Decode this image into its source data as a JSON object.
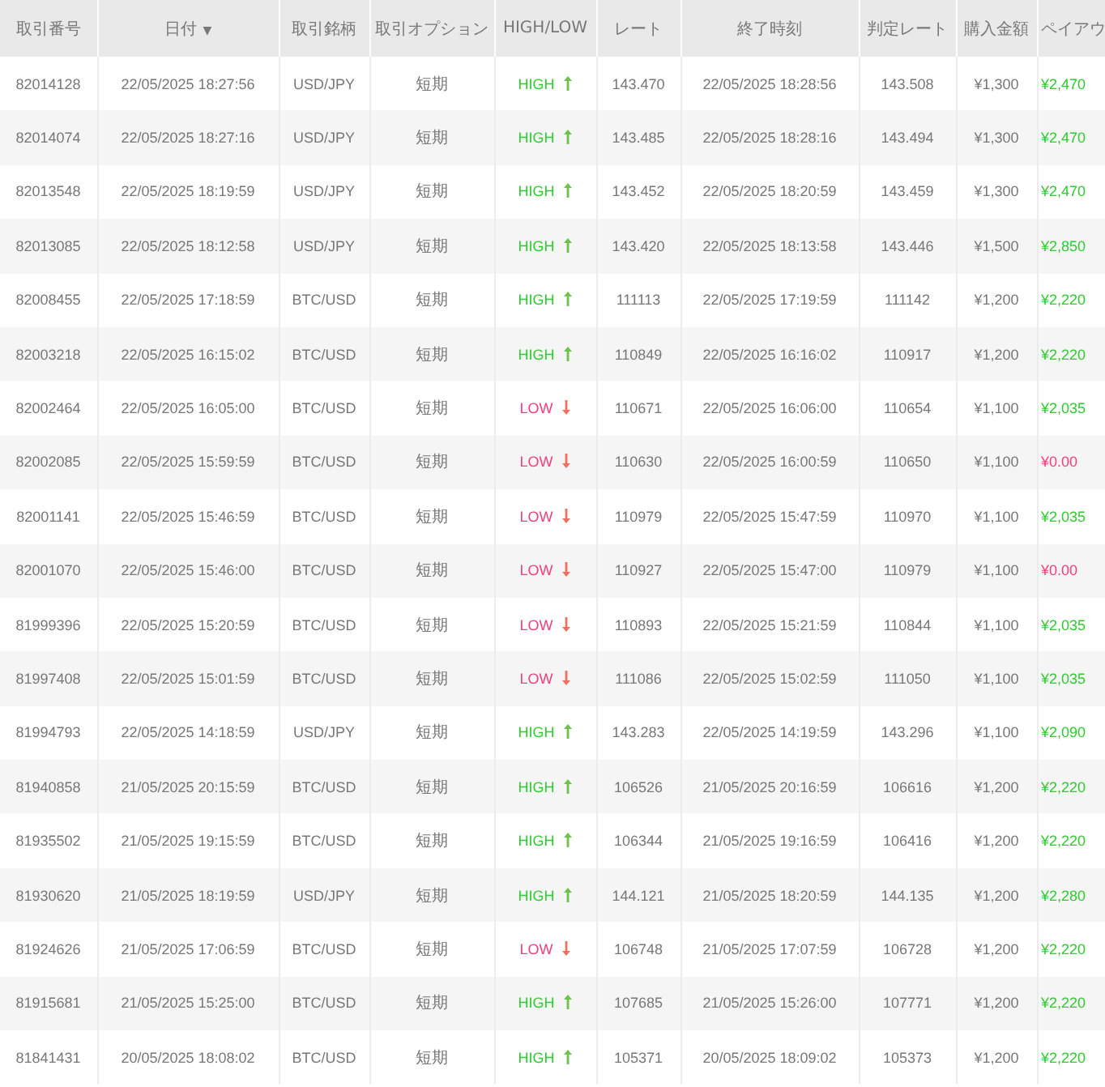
{
  "table": {
    "columns": [
      {
        "label": "取引番号"
      },
      {
        "label": "日付",
        "sort_indicator": "▼"
      },
      {
        "label": "取引銘柄"
      },
      {
        "label": "取引オプション"
      },
      {
        "label": "HIGH/LOW"
      },
      {
        "label": "レート"
      },
      {
        "label": "終了時刻"
      },
      {
        "label": "判定レート"
      },
      {
        "label": "購入金額"
      },
      {
        "label": "ペイアウ"
      }
    ],
    "rows": [
      {
        "id": "82014128",
        "date": "22/05/2025 18:27:56",
        "pair": "USD/JPY",
        "option": "短期",
        "direction": "HIGH",
        "kind": "high",
        "rate": "143.470",
        "end": "22/05/2025 18:28:56",
        "judge": "143.508",
        "amount": "¥1,300",
        "payout": "¥2,470",
        "won": true
      },
      {
        "id": "82014074",
        "date": "22/05/2025 18:27:16",
        "pair": "USD/JPY",
        "option": "短期",
        "direction": "HIGH",
        "kind": "high",
        "rate": "143.485",
        "end": "22/05/2025 18:28:16",
        "judge": "143.494",
        "amount": "¥1,300",
        "payout": "¥2,470",
        "won": true
      },
      {
        "id": "82013548",
        "date": "22/05/2025 18:19:59",
        "pair": "USD/JPY",
        "option": "短期",
        "direction": "HIGH",
        "kind": "high",
        "rate": "143.452",
        "end": "22/05/2025 18:20:59",
        "judge": "143.459",
        "amount": "¥1,300",
        "payout": "¥2,470",
        "won": true
      },
      {
        "id": "82013085",
        "date": "22/05/2025 18:12:58",
        "pair": "USD/JPY",
        "option": "短期",
        "direction": "HIGH",
        "kind": "high",
        "rate": "143.420",
        "end": "22/05/2025 18:13:58",
        "judge": "143.446",
        "amount": "¥1,500",
        "payout": "¥2,850",
        "won": true
      },
      {
        "id": "82008455",
        "date": "22/05/2025 17:18:59",
        "pair": "BTC/USD",
        "option": "短期",
        "direction": "HIGH",
        "kind": "high",
        "rate": "111113",
        "end": "22/05/2025 17:19:59",
        "judge": "111142",
        "amount": "¥1,200",
        "payout": "¥2,220",
        "won": true
      },
      {
        "id": "82003218",
        "date": "22/05/2025 16:15:02",
        "pair": "BTC/USD",
        "option": "短期",
        "direction": "HIGH",
        "kind": "high",
        "rate": "110849",
        "end": "22/05/2025 16:16:02",
        "judge": "110917",
        "amount": "¥1,200",
        "payout": "¥2,220",
        "won": true
      },
      {
        "id": "82002464",
        "date": "22/05/2025 16:05:00",
        "pair": "BTC/USD",
        "option": "短期",
        "direction": "LOW",
        "kind": "low",
        "rate": "110671",
        "end": "22/05/2025 16:06:00",
        "judge": "110654",
        "amount": "¥1,100",
        "payout": "¥2,035",
        "won": true
      },
      {
        "id": "82002085",
        "date": "22/05/2025 15:59:59",
        "pair": "BTC/USD",
        "option": "短期",
        "direction": "LOW",
        "kind": "low",
        "rate": "110630",
        "end": "22/05/2025 16:00:59",
        "judge": "110650",
        "amount": "¥1,100",
        "payout": "¥0.00",
        "won": false
      },
      {
        "id": "82001141",
        "date": "22/05/2025 15:46:59",
        "pair": "BTC/USD",
        "option": "短期",
        "direction": "LOW",
        "kind": "low",
        "rate": "110979",
        "end": "22/05/2025 15:47:59",
        "judge": "110970",
        "amount": "¥1,100",
        "payout": "¥2,035",
        "won": true
      },
      {
        "id": "82001070",
        "date": "22/05/2025 15:46:00",
        "pair": "BTC/USD",
        "option": "短期",
        "direction": "LOW",
        "kind": "low",
        "rate": "110927",
        "end": "22/05/2025 15:47:00",
        "judge": "110979",
        "amount": "¥1,100",
        "payout": "¥0.00",
        "won": false
      },
      {
        "id": "81999396",
        "date": "22/05/2025 15:20:59",
        "pair": "BTC/USD",
        "option": "短期",
        "direction": "LOW",
        "kind": "low",
        "rate": "110893",
        "end": "22/05/2025 15:21:59",
        "judge": "110844",
        "amount": "¥1,100",
        "payout": "¥2,035",
        "won": true
      },
      {
        "id": "81997408",
        "date": "22/05/2025 15:01:59",
        "pair": "BTC/USD",
        "option": "短期",
        "direction": "LOW",
        "kind": "low",
        "rate": "111086",
        "end": "22/05/2025 15:02:59",
        "judge": "111050",
        "amount": "¥1,100",
        "payout": "¥2,035",
        "won": true
      },
      {
        "id": "81994793",
        "date": "22/05/2025 14:18:59",
        "pair": "USD/JPY",
        "option": "短期",
        "direction": "HIGH",
        "kind": "high",
        "rate": "143.283",
        "end": "22/05/2025 14:19:59",
        "judge": "143.296",
        "amount": "¥1,100",
        "payout": "¥2,090",
        "won": true
      },
      {
        "id": "81940858",
        "date": "21/05/2025 20:15:59",
        "pair": "BTC/USD",
        "option": "短期",
        "direction": "HIGH",
        "kind": "high",
        "rate": "106526",
        "end": "21/05/2025 20:16:59",
        "judge": "106616",
        "amount": "¥1,200",
        "payout": "¥2,220",
        "won": true
      },
      {
        "id": "81935502",
        "date": "21/05/2025 19:15:59",
        "pair": "BTC/USD",
        "option": "短期",
        "direction": "HIGH",
        "kind": "high",
        "rate": "106344",
        "end": "21/05/2025 19:16:59",
        "judge": "106416",
        "amount": "¥1,200",
        "payout": "¥2,220",
        "won": true
      },
      {
        "id": "81930620",
        "date": "21/05/2025 18:19:59",
        "pair": "USD/JPY",
        "option": "短期",
        "direction": "HIGH",
        "kind": "high",
        "rate": "144.121",
        "end": "21/05/2025 18:20:59",
        "judge": "144.135",
        "amount": "¥1,200",
        "payout": "¥2,280",
        "won": true
      },
      {
        "id": "81924626",
        "date": "21/05/2025 17:06:59",
        "pair": "BTC/USD",
        "option": "短期",
        "direction": "LOW",
        "kind": "low",
        "rate": "106748",
        "end": "21/05/2025 17:07:59",
        "judge": "106728",
        "amount": "¥1,200",
        "payout": "¥2,220",
        "won": true
      },
      {
        "id": "81915681",
        "date": "21/05/2025 15:25:00",
        "pair": "BTC/USD",
        "option": "短期",
        "direction": "HIGH",
        "kind": "high",
        "rate": "107685",
        "end": "21/05/2025 15:26:00",
        "judge": "107771",
        "amount": "¥1,200",
        "payout": "¥2,220",
        "won": true
      },
      {
        "id": "81841431",
        "date": "20/05/2025 18:08:02",
        "pair": "BTC/USD",
        "option": "短期",
        "direction": "HIGH",
        "kind": "high",
        "rate": "105371",
        "end": "20/05/2025 18:09:02",
        "judge": "105373",
        "amount": "¥1,200",
        "payout": "¥2,220",
        "won": true
      }
    ]
  }
}
